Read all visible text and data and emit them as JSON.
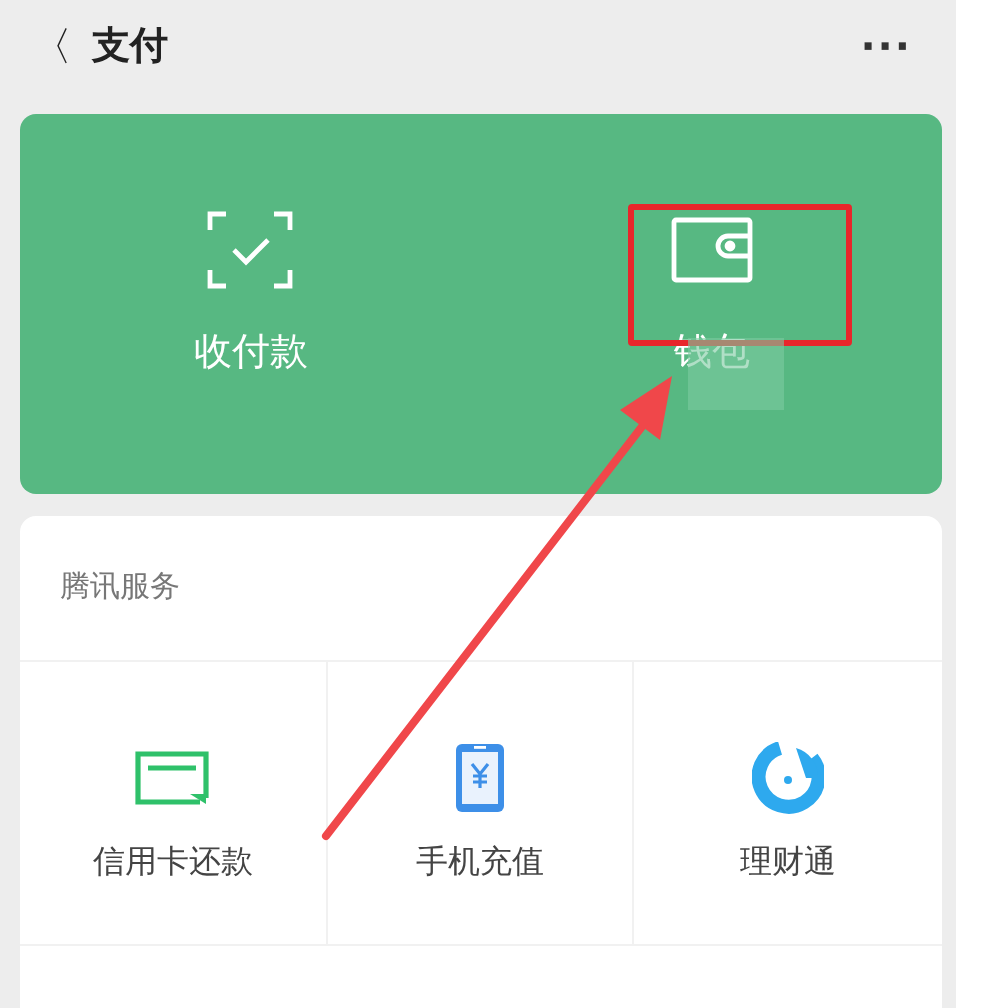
{
  "header": {
    "back": "〈",
    "title": "支付",
    "more": "···"
  },
  "actions": [
    {
      "label": "收付款",
      "kind": "scan",
      "highlighted": false
    },
    {
      "label": "钱包",
      "kind": "wallet",
      "highlighted": true
    }
  ],
  "pointer_arrow": true,
  "services": {
    "title": "腾讯服务",
    "items": [
      {
        "label": "信用卡还款",
        "kind": "card"
      },
      {
        "label": "手机充值",
        "kind": "phone"
      },
      {
        "label": "理财通",
        "kind": "wealth"
      }
    ]
  }
}
